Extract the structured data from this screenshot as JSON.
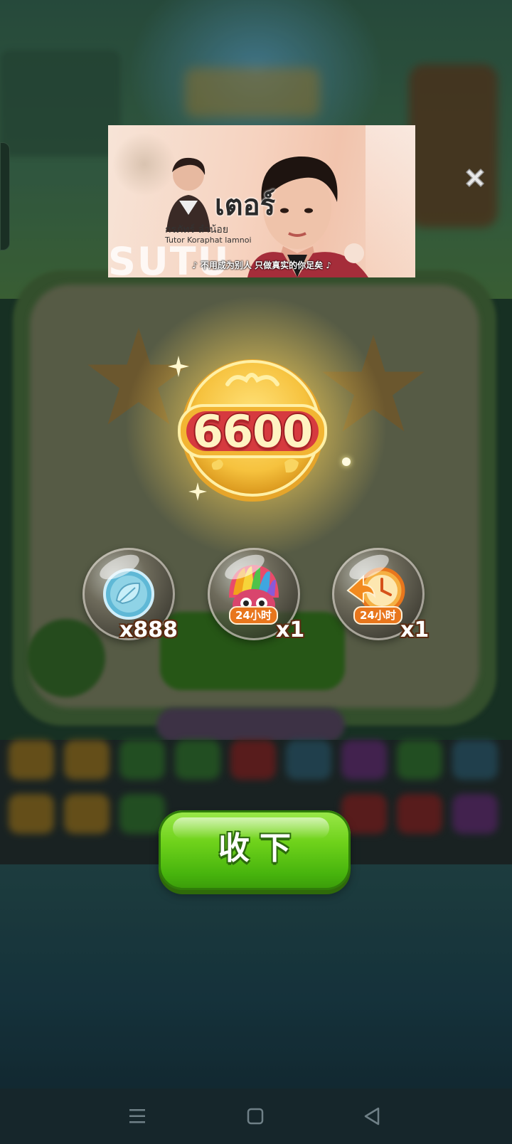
{
  "ad": {
    "thai_title": "เตอร์",
    "thai_subtitle": "กรภัทร์ ลำน้อย",
    "english_name": "Tutor Koraphat lamnoi",
    "caption": "♪ 不用成为别人 只做真实的你足矣 ♪"
  },
  "reward": {
    "coin_value": "6600",
    "items": [
      {
        "icon": "leaf-coin-icon",
        "quantity": "x888"
      },
      {
        "icon": "rainbow-owl-icon",
        "badge": "24小时",
        "quantity": "x1"
      },
      {
        "icon": "clock-arrow-icon",
        "badge": "24小时",
        "quantity": "x1"
      }
    ]
  },
  "collect_button": {
    "label": "收下"
  },
  "colors": {
    "button_green": "#6fd21b",
    "coin_gold": "#f6c23e",
    "coin_banner_red": "#d63a3f",
    "badge_orange": "#e8761d"
  }
}
